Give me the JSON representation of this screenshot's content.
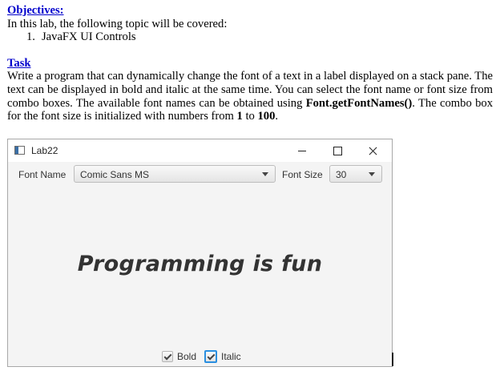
{
  "document": {
    "objectives_heading": "Objectives:",
    "objectives_intro": "In this lab, the following topic will be covered:",
    "objectives_items": [
      {
        "number": "1.",
        "text": "JavaFX UI Controls"
      }
    ],
    "task_heading": "Task",
    "task_text_1": "Write a program that can dynamically change the font of a text in a label displayed on a stack pane. The text can be displayed in bold and italic at the same time. You can select the font name or font size from combo boxes. The available font names can be obtained using ",
    "task_code": "Font.getFontNames()",
    "task_text_2": ". The combo box for the font size is initialized with numbers from ",
    "task_num_from": "1",
    "task_text_3": " to ",
    "task_num_to": "100",
    "task_text_4": "."
  },
  "window": {
    "title": "Lab22",
    "font_name_label": "Font Name",
    "font_name_value": "Comic Sans MS",
    "font_size_label": "Font Size",
    "font_size_value": "30",
    "sample_text": "Programming is fun",
    "bold_label": "Bold",
    "bold_checked": true,
    "italic_label": "Italic",
    "italic_checked": true
  }
}
